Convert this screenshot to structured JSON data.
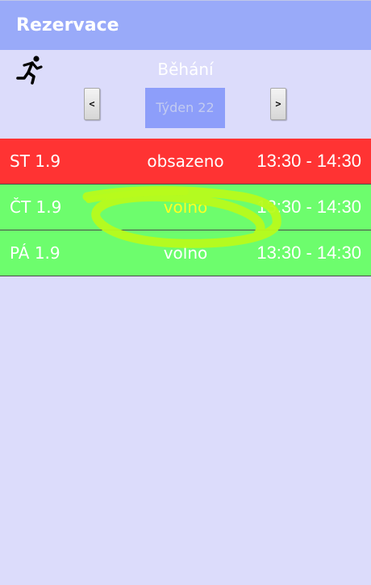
{
  "app": {
    "title": "Rezervace"
  },
  "header": {
    "activity": "Běhání",
    "activity_icon": "running-person-icon",
    "prev_label": "<",
    "next_label": ">",
    "week_label": "Týden 22"
  },
  "slots": [
    {
      "day": "ST 1.9",
      "status": "obsazeno",
      "time": "13:30 - 14:30",
      "state": "taken"
    },
    {
      "day": "ČT 1.9",
      "status": "volno",
      "time": "13:30 - 14:30",
      "state": "free"
    },
    {
      "day": "PÁ 1.9",
      "status": "volno",
      "time": "13:30 - 14:30",
      "state": "free"
    }
  ],
  "colors": {
    "appbar": "#99aaf9",
    "background": "#dcdcfb",
    "taken": "#ff3333",
    "free": "#6dfd6d",
    "week_button": "#8d9efa",
    "scribble": "#b8fb1c"
  }
}
